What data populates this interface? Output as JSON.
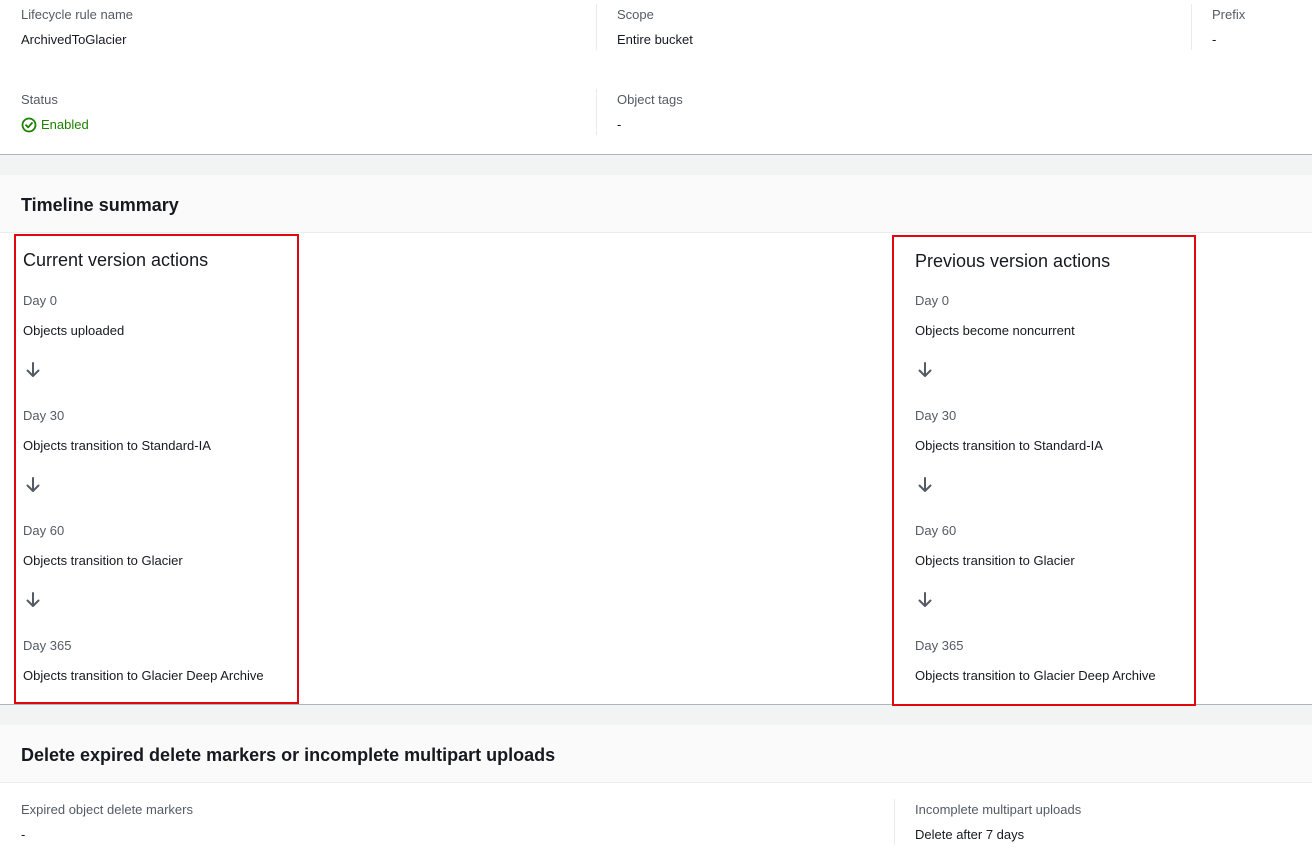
{
  "rule": {
    "name_label": "Lifecycle rule name",
    "name_value": "ArchivedToGlacier",
    "scope_label": "Scope",
    "scope_value": "Entire bucket",
    "prefix_label": "Prefix",
    "prefix_value": "-",
    "status_label": "Status",
    "status_value": "Enabled",
    "status_icon": "check-circle-icon",
    "status_color": "#1d8102",
    "tags_label": "Object tags",
    "tags_value": "-"
  },
  "timeline": {
    "title": "Timeline summary",
    "current": {
      "title": "Current version actions",
      "steps": [
        {
          "day": "Day 0",
          "text": "Objects uploaded"
        },
        {
          "day": "Day 30",
          "text": "Objects transition to Standard-IA"
        },
        {
          "day": "Day 60",
          "text": "Objects transition to Glacier"
        },
        {
          "day": "Day 365",
          "text": "Objects transition to Glacier Deep Archive"
        }
      ]
    },
    "previous": {
      "title": "Previous version actions",
      "steps": [
        {
          "day": "Day 0",
          "text": "Objects become noncurrent"
        },
        {
          "day": "Day 30",
          "text": "Objects transition to Standard-IA"
        },
        {
          "day": "Day 60",
          "text": "Objects transition to Glacier"
        },
        {
          "day": "Day 365",
          "text": "Objects transition to Glacier Deep Archive"
        }
      ]
    },
    "arrow_icon": "arrow-down-icon",
    "highlight_color": "#e0070e"
  },
  "deletes": {
    "title": "Delete expired delete markers or incomplete multipart uploads",
    "expired_label": "Expired object delete markers",
    "expired_value": "-",
    "multipart_label": "Incomplete multipart uploads",
    "multipart_value": "Delete after 7 days"
  }
}
